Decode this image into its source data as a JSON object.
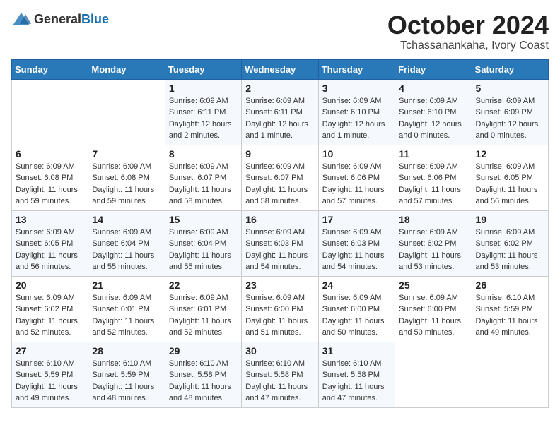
{
  "logo": {
    "general": "General",
    "blue": "Blue"
  },
  "header": {
    "month": "October 2024",
    "location": "Tchassanankaha, Ivory Coast"
  },
  "weekdays": [
    "Sunday",
    "Monday",
    "Tuesday",
    "Wednesday",
    "Thursday",
    "Friday",
    "Saturday"
  ],
  "weeks": [
    [
      {
        "day": "",
        "info": ""
      },
      {
        "day": "",
        "info": ""
      },
      {
        "day": "1",
        "info": "Sunrise: 6:09 AM\nSunset: 6:11 PM\nDaylight: 12 hours\nand 2 minutes."
      },
      {
        "day": "2",
        "info": "Sunrise: 6:09 AM\nSunset: 6:11 PM\nDaylight: 12 hours\nand 1 minute."
      },
      {
        "day": "3",
        "info": "Sunrise: 6:09 AM\nSunset: 6:10 PM\nDaylight: 12 hours\nand 1 minute."
      },
      {
        "day": "4",
        "info": "Sunrise: 6:09 AM\nSunset: 6:10 PM\nDaylight: 12 hours\nand 0 minutes."
      },
      {
        "day": "5",
        "info": "Sunrise: 6:09 AM\nSunset: 6:09 PM\nDaylight: 12 hours\nand 0 minutes."
      }
    ],
    [
      {
        "day": "6",
        "info": "Sunrise: 6:09 AM\nSunset: 6:08 PM\nDaylight: 11 hours\nand 59 minutes."
      },
      {
        "day": "7",
        "info": "Sunrise: 6:09 AM\nSunset: 6:08 PM\nDaylight: 11 hours\nand 59 minutes."
      },
      {
        "day": "8",
        "info": "Sunrise: 6:09 AM\nSunset: 6:07 PM\nDaylight: 11 hours\nand 58 minutes."
      },
      {
        "day": "9",
        "info": "Sunrise: 6:09 AM\nSunset: 6:07 PM\nDaylight: 11 hours\nand 58 minutes."
      },
      {
        "day": "10",
        "info": "Sunrise: 6:09 AM\nSunset: 6:06 PM\nDaylight: 11 hours\nand 57 minutes."
      },
      {
        "day": "11",
        "info": "Sunrise: 6:09 AM\nSunset: 6:06 PM\nDaylight: 11 hours\nand 57 minutes."
      },
      {
        "day": "12",
        "info": "Sunrise: 6:09 AM\nSunset: 6:05 PM\nDaylight: 11 hours\nand 56 minutes."
      }
    ],
    [
      {
        "day": "13",
        "info": "Sunrise: 6:09 AM\nSunset: 6:05 PM\nDaylight: 11 hours\nand 56 minutes."
      },
      {
        "day": "14",
        "info": "Sunrise: 6:09 AM\nSunset: 6:04 PM\nDaylight: 11 hours\nand 55 minutes."
      },
      {
        "day": "15",
        "info": "Sunrise: 6:09 AM\nSunset: 6:04 PM\nDaylight: 11 hours\nand 55 minutes."
      },
      {
        "day": "16",
        "info": "Sunrise: 6:09 AM\nSunset: 6:03 PM\nDaylight: 11 hours\nand 54 minutes."
      },
      {
        "day": "17",
        "info": "Sunrise: 6:09 AM\nSunset: 6:03 PM\nDaylight: 11 hours\nand 54 minutes."
      },
      {
        "day": "18",
        "info": "Sunrise: 6:09 AM\nSunset: 6:02 PM\nDaylight: 11 hours\nand 53 minutes."
      },
      {
        "day": "19",
        "info": "Sunrise: 6:09 AM\nSunset: 6:02 PM\nDaylight: 11 hours\nand 53 minutes."
      }
    ],
    [
      {
        "day": "20",
        "info": "Sunrise: 6:09 AM\nSunset: 6:02 PM\nDaylight: 11 hours\nand 52 minutes."
      },
      {
        "day": "21",
        "info": "Sunrise: 6:09 AM\nSunset: 6:01 PM\nDaylight: 11 hours\nand 52 minutes."
      },
      {
        "day": "22",
        "info": "Sunrise: 6:09 AM\nSunset: 6:01 PM\nDaylight: 11 hours\nand 52 minutes."
      },
      {
        "day": "23",
        "info": "Sunrise: 6:09 AM\nSunset: 6:00 PM\nDaylight: 11 hours\nand 51 minutes."
      },
      {
        "day": "24",
        "info": "Sunrise: 6:09 AM\nSunset: 6:00 PM\nDaylight: 11 hours\nand 50 minutes."
      },
      {
        "day": "25",
        "info": "Sunrise: 6:09 AM\nSunset: 6:00 PM\nDaylight: 11 hours\nand 50 minutes."
      },
      {
        "day": "26",
        "info": "Sunrise: 6:10 AM\nSunset: 5:59 PM\nDaylight: 11 hours\nand 49 minutes."
      }
    ],
    [
      {
        "day": "27",
        "info": "Sunrise: 6:10 AM\nSunset: 5:59 PM\nDaylight: 11 hours\nand 49 minutes."
      },
      {
        "day": "28",
        "info": "Sunrise: 6:10 AM\nSunset: 5:59 PM\nDaylight: 11 hours\nand 48 minutes."
      },
      {
        "day": "29",
        "info": "Sunrise: 6:10 AM\nSunset: 5:58 PM\nDaylight: 11 hours\nand 48 minutes."
      },
      {
        "day": "30",
        "info": "Sunrise: 6:10 AM\nSunset: 5:58 PM\nDaylight: 11 hours\nand 47 minutes."
      },
      {
        "day": "31",
        "info": "Sunrise: 6:10 AM\nSunset: 5:58 PM\nDaylight: 11 hours\nand 47 minutes."
      },
      {
        "day": "",
        "info": ""
      },
      {
        "day": "",
        "info": ""
      }
    ]
  ]
}
